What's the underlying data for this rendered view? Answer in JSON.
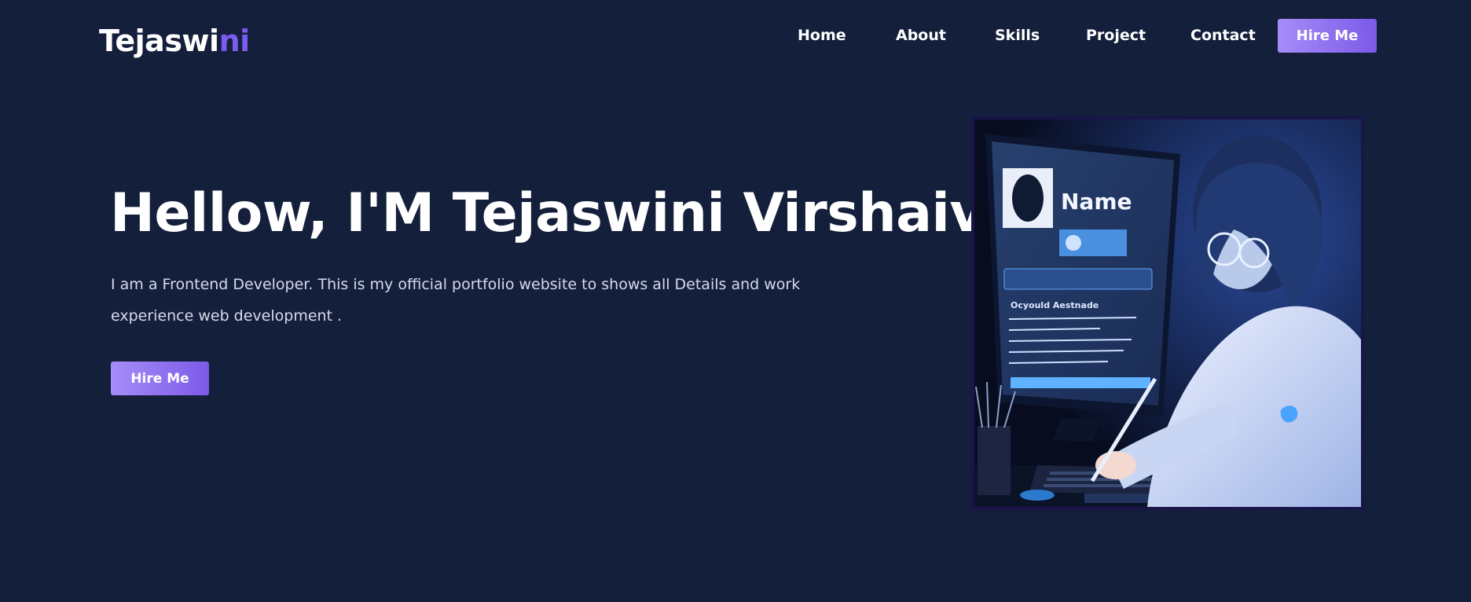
{
  "header": {
    "logo_main": "Tejaswi",
    "logo_accent": "ni",
    "nav": [
      "Home",
      "About",
      "Skills",
      "Project",
      "Contact"
    ],
    "hire_label": "Hire Me"
  },
  "hero": {
    "title": "Hellow, I'M Tejaswini Virshaiv .",
    "description": "I am a Frontend Developer. This is my official portfolio website to shows all Details and work experience web development .",
    "hire_label": "Hire Me"
  },
  "illustration": {
    "screen_name": "Name",
    "screen_heading": "Ocyould Aestnade"
  },
  "colors": {
    "background": "#141f3b",
    "accent": "#7c5cf0",
    "button_gradient_start": "#a68cf8",
    "button_gradient_end": "#7b5ae8"
  }
}
